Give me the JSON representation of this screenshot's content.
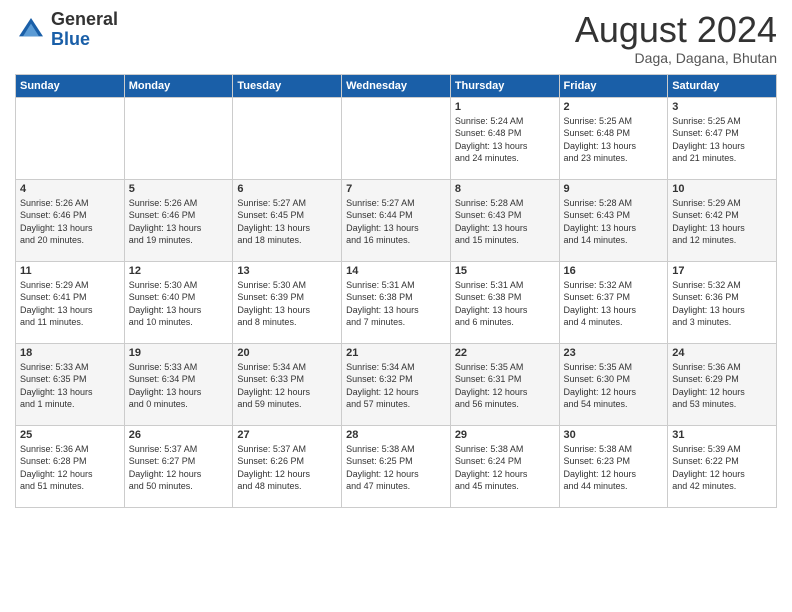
{
  "header": {
    "logo_general": "General",
    "logo_blue": "Blue",
    "month_title": "August 2024",
    "subtitle": "Daga, Dagana, Bhutan"
  },
  "days_of_week": [
    "Sunday",
    "Monday",
    "Tuesday",
    "Wednesday",
    "Thursday",
    "Friday",
    "Saturday"
  ],
  "weeks": [
    [
      {
        "day": "",
        "info": ""
      },
      {
        "day": "",
        "info": ""
      },
      {
        "day": "",
        "info": ""
      },
      {
        "day": "",
        "info": ""
      },
      {
        "day": "1",
        "info": "Sunrise: 5:24 AM\nSunset: 6:48 PM\nDaylight: 13 hours\nand 24 minutes."
      },
      {
        "day": "2",
        "info": "Sunrise: 5:25 AM\nSunset: 6:48 PM\nDaylight: 13 hours\nand 23 minutes."
      },
      {
        "day": "3",
        "info": "Sunrise: 5:25 AM\nSunset: 6:47 PM\nDaylight: 13 hours\nand 21 minutes."
      }
    ],
    [
      {
        "day": "4",
        "info": "Sunrise: 5:26 AM\nSunset: 6:46 PM\nDaylight: 13 hours\nand 20 minutes."
      },
      {
        "day": "5",
        "info": "Sunrise: 5:26 AM\nSunset: 6:46 PM\nDaylight: 13 hours\nand 19 minutes."
      },
      {
        "day": "6",
        "info": "Sunrise: 5:27 AM\nSunset: 6:45 PM\nDaylight: 13 hours\nand 18 minutes."
      },
      {
        "day": "7",
        "info": "Sunrise: 5:27 AM\nSunset: 6:44 PM\nDaylight: 13 hours\nand 16 minutes."
      },
      {
        "day": "8",
        "info": "Sunrise: 5:28 AM\nSunset: 6:43 PM\nDaylight: 13 hours\nand 15 minutes."
      },
      {
        "day": "9",
        "info": "Sunrise: 5:28 AM\nSunset: 6:43 PM\nDaylight: 13 hours\nand 14 minutes."
      },
      {
        "day": "10",
        "info": "Sunrise: 5:29 AM\nSunset: 6:42 PM\nDaylight: 13 hours\nand 12 minutes."
      }
    ],
    [
      {
        "day": "11",
        "info": "Sunrise: 5:29 AM\nSunset: 6:41 PM\nDaylight: 13 hours\nand 11 minutes."
      },
      {
        "day": "12",
        "info": "Sunrise: 5:30 AM\nSunset: 6:40 PM\nDaylight: 13 hours\nand 10 minutes."
      },
      {
        "day": "13",
        "info": "Sunrise: 5:30 AM\nSunset: 6:39 PM\nDaylight: 13 hours\nand 8 minutes."
      },
      {
        "day": "14",
        "info": "Sunrise: 5:31 AM\nSunset: 6:38 PM\nDaylight: 13 hours\nand 7 minutes."
      },
      {
        "day": "15",
        "info": "Sunrise: 5:31 AM\nSunset: 6:38 PM\nDaylight: 13 hours\nand 6 minutes."
      },
      {
        "day": "16",
        "info": "Sunrise: 5:32 AM\nSunset: 6:37 PM\nDaylight: 13 hours\nand 4 minutes."
      },
      {
        "day": "17",
        "info": "Sunrise: 5:32 AM\nSunset: 6:36 PM\nDaylight: 13 hours\nand 3 minutes."
      }
    ],
    [
      {
        "day": "18",
        "info": "Sunrise: 5:33 AM\nSunset: 6:35 PM\nDaylight: 13 hours\nand 1 minute."
      },
      {
        "day": "19",
        "info": "Sunrise: 5:33 AM\nSunset: 6:34 PM\nDaylight: 13 hours\nand 0 minutes."
      },
      {
        "day": "20",
        "info": "Sunrise: 5:34 AM\nSunset: 6:33 PM\nDaylight: 12 hours\nand 59 minutes."
      },
      {
        "day": "21",
        "info": "Sunrise: 5:34 AM\nSunset: 6:32 PM\nDaylight: 12 hours\nand 57 minutes."
      },
      {
        "day": "22",
        "info": "Sunrise: 5:35 AM\nSunset: 6:31 PM\nDaylight: 12 hours\nand 56 minutes."
      },
      {
        "day": "23",
        "info": "Sunrise: 5:35 AM\nSunset: 6:30 PM\nDaylight: 12 hours\nand 54 minutes."
      },
      {
        "day": "24",
        "info": "Sunrise: 5:36 AM\nSunset: 6:29 PM\nDaylight: 12 hours\nand 53 minutes."
      }
    ],
    [
      {
        "day": "25",
        "info": "Sunrise: 5:36 AM\nSunset: 6:28 PM\nDaylight: 12 hours\nand 51 minutes."
      },
      {
        "day": "26",
        "info": "Sunrise: 5:37 AM\nSunset: 6:27 PM\nDaylight: 12 hours\nand 50 minutes."
      },
      {
        "day": "27",
        "info": "Sunrise: 5:37 AM\nSunset: 6:26 PM\nDaylight: 12 hours\nand 48 minutes."
      },
      {
        "day": "28",
        "info": "Sunrise: 5:38 AM\nSunset: 6:25 PM\nDaylight: 12 hours\nand 47 minutes."
      },
      {
        "day": "29",
        "info": "Sunrise: 5:38 AM\nSunset: 6:24 PM\nDaylight: 12 hours\nand 45 minutes."
      },
      {
        "day": "30",
        "info": "Sunrise: 5:38 AM\nSunset: 6:23 PM\nDaylight: 12 hours\nand 44 minutes."
      },
      {
        "day": "31",
        "info": "Sunrise: 5:39 AM\nSunset: 6:22 PM\nDaylight: 12 hours\nand 42 minutes."
      }
    ]
  ]
}
